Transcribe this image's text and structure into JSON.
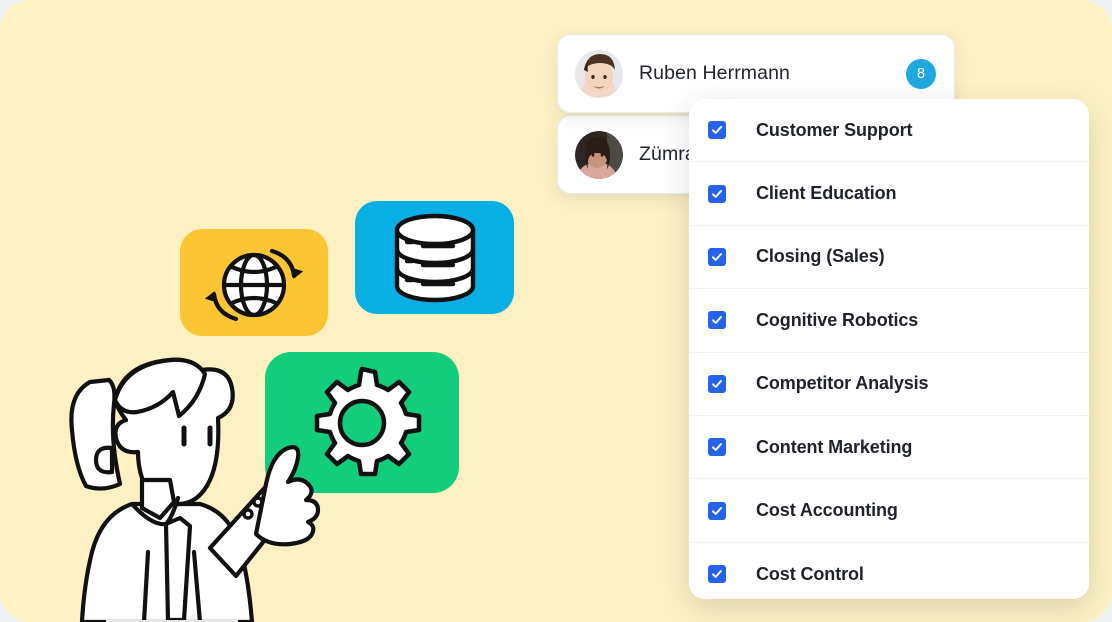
{
  "canvas": {
    "background_color": "#FDF1C4",
    "outer_background_color": "#eef1f4"
  },
  "illustration": {
    "tiles": [
      {
        "name": "globe-sync",
        "icon": "globe-refresh-icon",
        "color": "#FCC533"
      },
      {
        "name": "database",
        "icon": "database-icon",
        "color": "#07AFE4"
      },
      {
        "name": "settings-gear",
        "icon": "gear-icon",
        "color": "#12CE7C"
      }
    ],
    "character": {
      "name": "woman-pointing",
      "description": "line-art cartoon woman in lab coat pointing at the gear tile"
    }
  },
  "user_list": {
    "rows": [
      {
        "name": "Ruben Herrmann",
        "avatar": "avatar-male-photo",
        "badge": "8",
        "badge_color": "#1FA8E0"
      },
      {
        "name": "Zümra",
        "avatar": "avatar-female-photo",
        "badge": "",
        "badge_color": "#1FA8E0"
      }
    ]
  },
  "dropdown": {
    "checkbox_color": "#2563EB",
    "items": [
      {
        "label": "Customer Support",
        "checked": true
      },
      {
        "label": "Client Education",
        "checked": true
      },
      {
        "label": "Closing (Sales)",
        "checked": true
      },
      {
        "label": "Cognitive Robotics",
        "checked": true
      },
      {
        "label": "Competitor Analysis",
        "checked": true
      },
      {
        "label": "Content Marketing",
        "checked": true
      },
      {
        "label": "Cost Accounting",
        "checked": true
      },
      {
        "label": "Cost Control",
        "checked": true
      }
    ]
  }
}
